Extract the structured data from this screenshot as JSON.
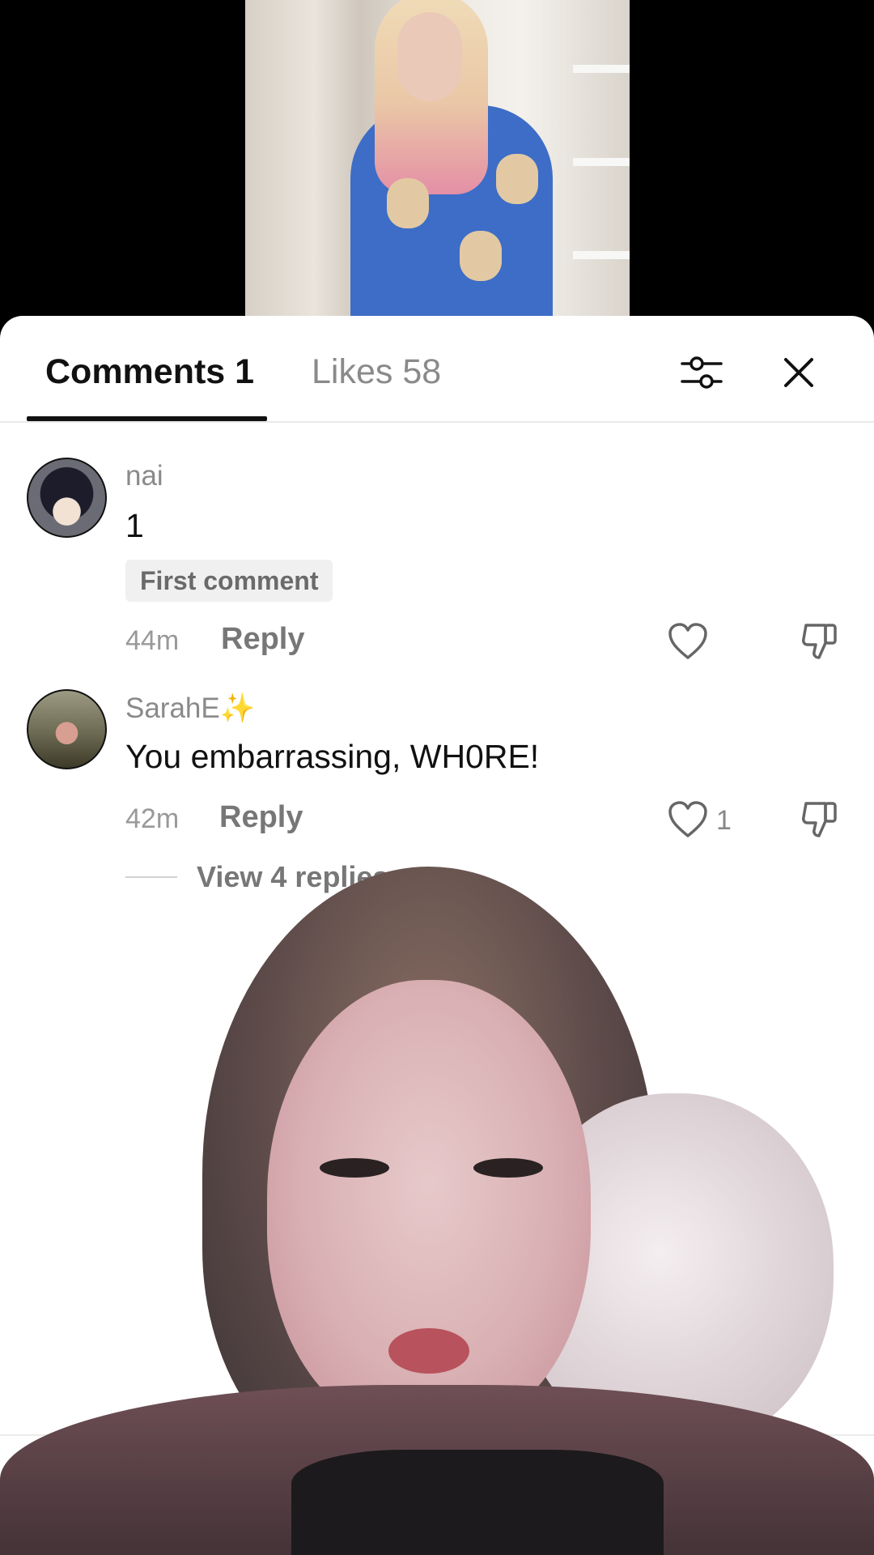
{
  "tabs": {
    "comments_label": "Comments 1",
    "likes_label": "Likes 58"
  },
  "icons": {
    "filter": "sliders-icon",
    "close": "close-icon",
    "like": "heart-icon",
    "dislike": "thumbs-down-icon"
  },
  "comments": [
    {
      "username": "nai",
      "text": "1",
      "badge": "First comment",
      "time": "44m",
      "reply_label": "Reply",
      "likes": ""
    },
    {
      "username": "SarahE✨",
      "text": "You embarrassing, WH0RE!",
      "badge": "",
      "time": "42m",
      "reply_label": "Reply",
      "likes": "1",
      "view_replies": "View 4 replies ⌄"
    }
  ],
  "colors": {
    "sheet_background": "#ffffff",
    "primary_text": "#111111",
    "secondary_text": "#8a8a8a"
  }
}
